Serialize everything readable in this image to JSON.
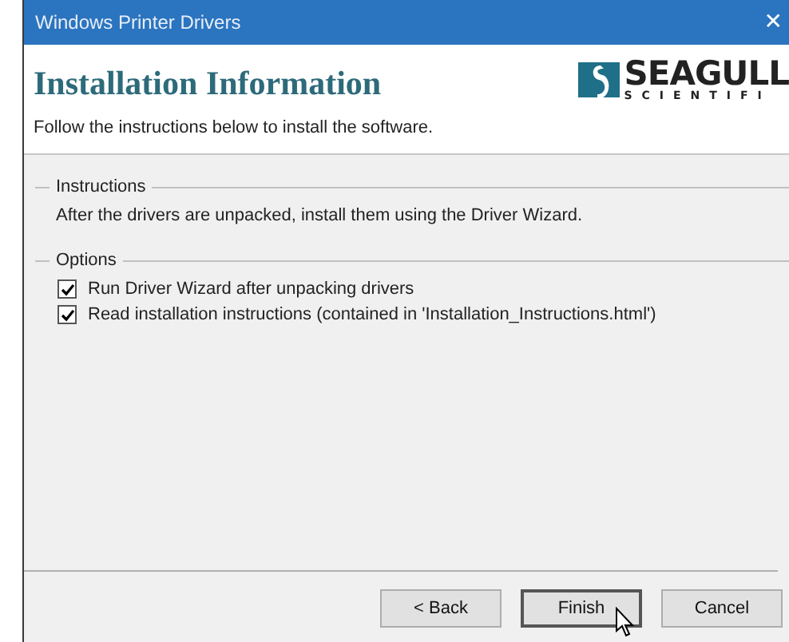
{
  "window": {
    "title": "Windows Printer Drivers",
    "close": "✕"
  },
  "header": {
    "title": "Installation Information",
    "subtitle": "Follow the instructions below to install the software.",
    "logo_name": "SEAGULL",
    "logo_tagline": "SCIENTIFI"
  },
  "instructions": {
    "legend": "Instructions",
    "text": "After the drivers are unpacked, install them using the Driver Wizard."
  },
  "options": {
    "legend": "Options",
    "items": [
      {
        "label": "Run Driver Wizard after unpacking drivers",
        "checked": true
      },
      {
        "label": "Read installation instructions (contained in 'Installation_Instructions.html')",
        "checked": true
      }
    ]
  },
  "buttons": [
    {
      "label": "< Back",
      "kind": "normal"
    },
    {
      "label": "Finish",
      "kind": "default"
    },
    {
      "label": "Cancel",
      "kind": "normal"
    }
  ]
}
